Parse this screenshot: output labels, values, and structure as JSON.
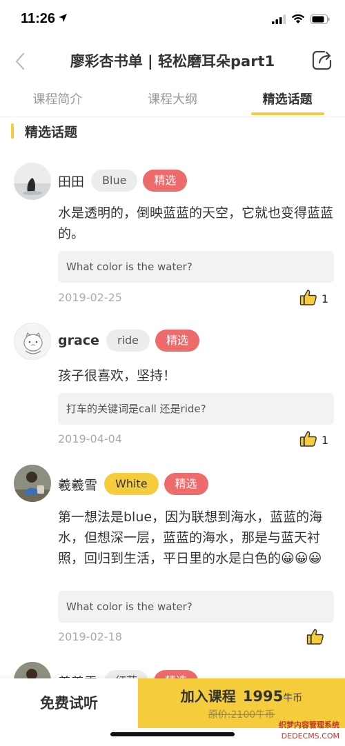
{
  "status_bar": {
    "time": "11:26"
  },
  "header": {
    "title": "廖彩杏书单 | 轻松磨耳朵part1"
  },
  "tabs": [
    {
      "label": "课程简介",
      "active": false
    },
    {
      "label": "课程大纲",
      "active": false
    },
    {
      "label": "精选话题",
      "active": true
    }
  ],
  "section": {
    "title": "精选话题"
  },
  "posts": [
    {
      "user": "田田",
      "tag": "Blue",
      "badge": "精选",
      "text": "水是透明的，倒映蓝蓝的天空，它就也变得蓝蓝的。",
      "question": "What color is the water?",
      "date": "2019-02-25",
      "likes": "1"
    },
    {
      "user": "grace",
      "tag": "ride",
      "badge": "精选",
      "text": "孩子很喜欢，坚持！",
      "question": "打车的关键词是call 还是ride?",
      "date": "2019-04-04",
      "likes": "1"
    },
    {
      "user": "羲羲雪",
      "tag": "White",
      "badge": "精选",
      "text": "第一想法是blue，因为联想到海水，蓝蓝的海水，但想深一层，蓝蓝的海水，那是与蓝天衬照，回归到生活，平日里的水是白色的",
      "emojis": "😀😀😀",
      "question": "What color is the water?",
      "date": "2019-02-18",
      "likes": ""
    },
    {
      "user": "羲羲雪",
      "tag": "红花",
      "badge": "精选"
    }
  ],
  "bottom_bar": {
    "free_listen": "免费试听",
    "join_label": "加入课程",
    "price": "1995",
    "price_unit": "牛币",
    "original_price": "原价:2100牛币"
  },
  "watermark": {
    "line1": "织梦内容管理系统",
    "line2": "DEDECMS.COM"
  },
  "colors": {
    "accent": "#f5cd3c",
    "badge_red": "#ee6b6b"
  },
  "icons": [
    "back-chevron-icon",
    "share-icon",
    "thumbs-up-icon",
    "location-arrow-icon",
    "signal-icon",
    "wifi-icon",
    "battery-icon"
  ]
}
